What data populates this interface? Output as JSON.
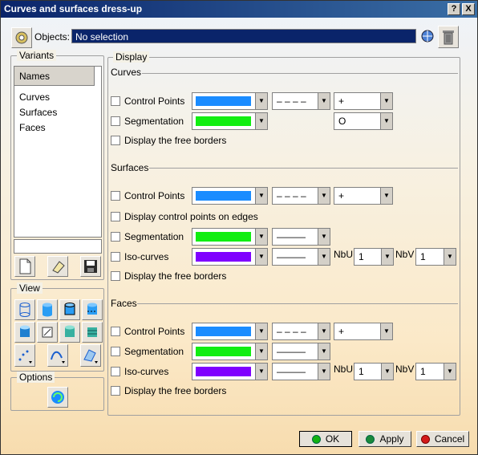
{
  "window": {
    "title": "Curves and surfaces dress-up",
    "help": "?",
    "close": "X"
  },
  "objects": {
    "label": "Objects:",
    "value": "No selection"
  },
  "variants": {
    "title": "Variants",
    "header": "Names",
    "items": [
      "Curves",
      "Surfaces",
      "Faces"
    ]
  },
  "view": {
    "title": "View"
  },
  "options": {
    "title": "Options"
  },
  "display": {
    "title": "Display",
    "curves": {
      "title": "Curves",
      "control_points": {
        "label": "Control Points",
        "color": "#1a8cff",
        "line": "– – – –",
        "symbol": "+"
      },
      "segmentation": {
        "label": "Segmentation",
        "color": "#11ee11",
        "symbol": "O"
      },
      "free_borders": {
        "label": "Display the free borders"
      }
    },
    "surfaces": {
      "title": "Surfaces",
      "control_points": {
        "label": "Control Points",
        "color": "#1a8cff",
        "line": "– – – –",
        "symbol": "+"
      },
      "on_edges": {
        "label": "Display control points on edges"
      },
      "segmentation": {
        "label": "Segmentation",
        "color": "#11ee11",
        "line": "———"
      },
      "iso_curves": {
        "label": "Iso-curves",
        "color": "#7f00ff",
        "line": "———",
        "nbu_label": "NbU",
        "nbu": "1",
        "nbv_label": "NbV",
        "nbv": "1"
      },
      "free_borders": {
        "label": "Display the free borders"
      }
    },
    "faces": {
      "title": "Faces",
      "control_points": {
        "label": "Control Points",
        "color": "#1a8cff",
        "line": "– – – –",
        "symbol": "+"
      },
      "segmentation": {
        "label": "Segmentation",
        "color": "#11ee11",
        "line": "———"
      },
      "iso_curves": {
        "label": "Iso-curves",
        "color": "#7f00ff",
        "line": "———",
        "nbu_label": "NbU",
        "nbu": "1",
        "nbv_label": "NbV",
        "nbv": "1"
      },
      "free_borders": {
        "label": "Display the free borders"
      }
    }
  },
  "buttons": {
    "ok": "OK",
    "apply": "Apply",
    "cancel": "Cancel"
  }
}
